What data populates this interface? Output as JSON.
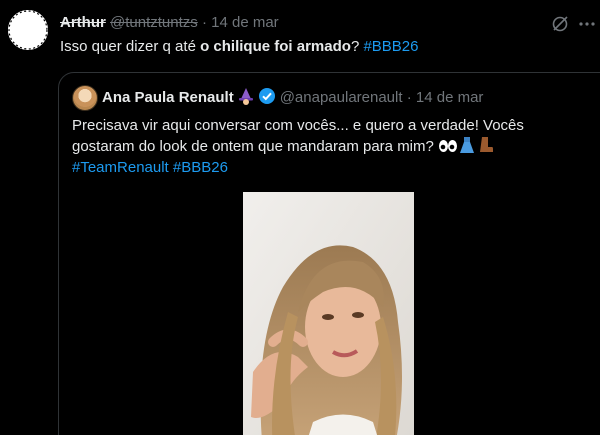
{
  "tweet": {
    "author_name": "Arthur",
    "author_handle": "@tuntztuntzs",
    "separator": "·",
    "date": "14 de mar",
    "text_prefix": "Isso quer dizer q até ",
    "text_bold": "o chilique foi armado",
    "text_suffix": "? ",
    "hashtag": "#BBB26"
  },
  "quote": {
    "author_name": "Ana Paula Renault",
    "author_handle": "@anapaularenault",
    "separator": "·",
    "date": "14 de mar",
    "line1": "Precisava vir aqui conversar com vocês... e quero a verdade! Vocês",
    "line2": "gostaram do look de ontem que mandaram para mim? ",
    "hashtag1": "#TeamRenault",
    "hashtag2": "#BBB26"
  },
  "colors": {
    "background": "#000000",
    "text": "#e7e9ea",
    "secondary": "#71767b",
    "link": "#1d9bf0",
    "border": "#2f3336",
    "verified": "#1d9bf0"
  },
  "icons": {
    "grok": "grok-icon",
    "more": "more-icon",
    "verified": "verified-badge-icon",
    "witch": "witch-emoji-icon",
    "eyes": "eyes-emoji-icon",
    "dress": "dress-emoji-icon",
    "boot": "boot-emoji-icon"
  }
}
